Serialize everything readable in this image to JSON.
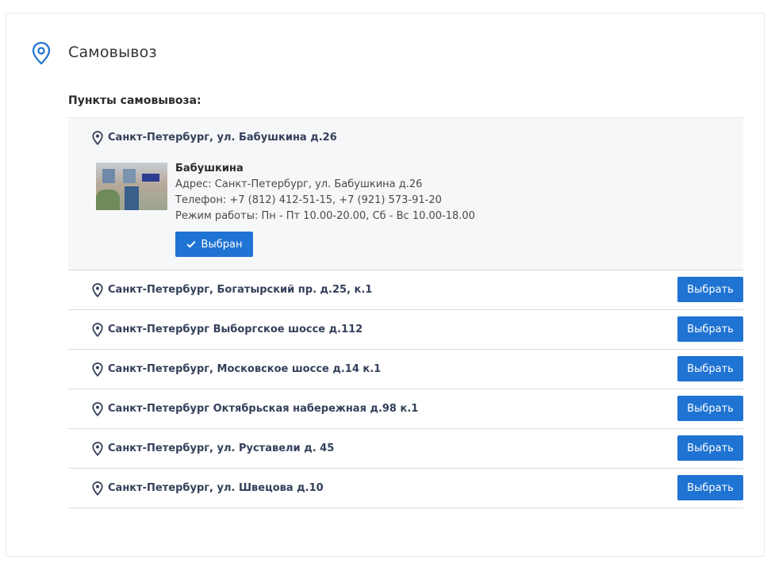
{
  "header": {
    "title": "Самовывоз",
    "icon": "location-pin-icon",
    "accent": "#1f73d2"
  },
  "pickup": {
    "subtitle": "Пункты самовывоза:",
    "selected": {
      "address": "Санкт-Петербург, ул. Бабушкина д.26",
      "name": "Бабушкина",
      "address_line": "Адрес: Санкт-Петербург, ул. Бабушкина д.26",
      "phone_line": "Телефон: +7 (812) 412-51-15, +7 (921) 573-91-20",
      "hours_line": "Режим работы: Пн - Пт 10.00-20.00, Сб - Вс 10.00-18.00",
      "button_label": "Выбран"
    },
    "points": [
      {
        "address": "Санкт-Петербург, Богатырский пр. д.25, к.1",
        "button_label": "Выбрать"
      },
      {
        "address": "Санкт-Петербург Выборгское шоссе д.112",
        "button_label": "Выбрать"
      },
      {
        "address": "Санкт-Петербург, Московское шоссе д.14 к.1",
        "button_label": "Выбрать"
      },
      {
        "address": "Санкт-Петербург Октябрьская набережная д.98 к.1",
        "button_label": "Выбрать"
      },
      {
        "address": "Санкт-Петербург, ул. Руставели д. 45",
        "button_label": "Выбрать"
      },
      {
        "address": "Санкт-Петербург, ул. Швецова д.10",
        "button_label": "Выбрать"
      }
    ]
  }
}
